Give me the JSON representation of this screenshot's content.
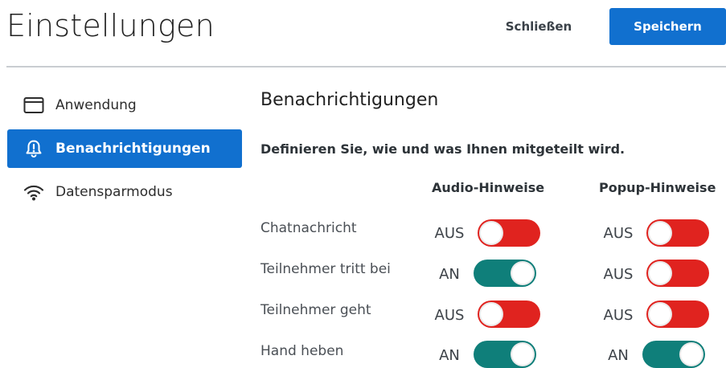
{
  "header": {
    "title": "Einstellungen",
    "close_label": "Schließen",
    "save_label": "Speichern"
  },
  "sidebar": {
    "items": [
      {
        "label": "Anwendung",
        "icon": "window-icon",
        "active": false
      },
      {
        "label": "Benachrichtigungen",
        "icon": "bell-alert-icon",
        "active": true
      },
      {
        "label": "Datensparmodus",
        "icon": "wifi-icon",
        "active": false
      }
    ]
  },
  "main": {
    "title": "Benachrichtigungen",
    "description": "Definieren Sie, wie und was Ihnen mitgeteilt wird.",
    "columns": [
      "Audio-Hinweise",
      "Popup-Hinweise"
    ],
    "rows": [
      {
        "label": "Chatnachricht",
        "audio": {
          "state": "AUS",
          "on": false
        },
        "popup": {
          "state": "AUS",
          "on": false
        }
      },
      {
        "label": "Teilnehmer tritt bei",
        "audio": {
          "state": "AN",
          "on": true
        },
        "popup": {
          "state": "AUS",
          "on": false
        }
      },
      {
        "label": "Teilnehmer geht",
        "audio": {
          "state": "AUS",
          "on": false
        },
        "popup": {
          "state": "AUS",
          "on": false
        }
      },
      {
        "label": "Hand heben",
        "audio": {
          "state": "AN",
          "on": true
        },
        "popup": {
          "state": "AN",
          "on": true
        }
      }
    ]
  },
  "colors": {
    "primary": "#1170cf",
    "toggle_on": "#0f7f7a",
    "toggle_off": "#e0231f"
  }
}
